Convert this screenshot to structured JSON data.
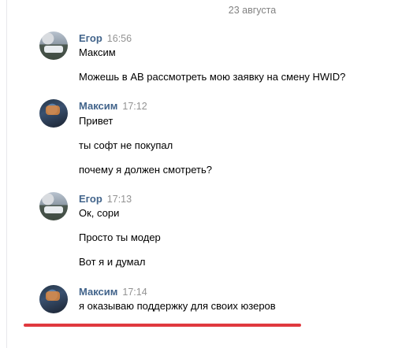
{
  "date_divider": "23 августа",
  "messages": [
    {
      "author": "Егор",
      "time": "16:56",
      "avatar": "egor-avatar",
      "lines": [
        "Максим",
        "Можешь в АВ рассмотреть мою заявку на смену HWID?"
      ]
    },
    {
      "author": "Максим",
      "time": "17:12",
      "avatar": "maxim-avatar",
      "lines": [
        "Привет",
        "ты софт не покупал",
        "почему я должен смотреть?"
      ]
    },
    {
      "author": "Егор",
      "time": "17:13",
      "avatar": "egor-avatar",
      "lines": [
        "Ок, сори",
        "Просто ты модер",
        "Вот я и думал"
      ]
    },
    {
      "author": "Максим",
      "time": "17:14",
      "avatar": "maxim-avatar",
      "lines": [
        "я оказываю поддержку для своих юзеров"
      ]
    }
  ],
  "colors": {
    "author": "#42648b",
    "time": "#939393",
    "text": "#000000",
    "highlight": "#e0393e"
  }
}
